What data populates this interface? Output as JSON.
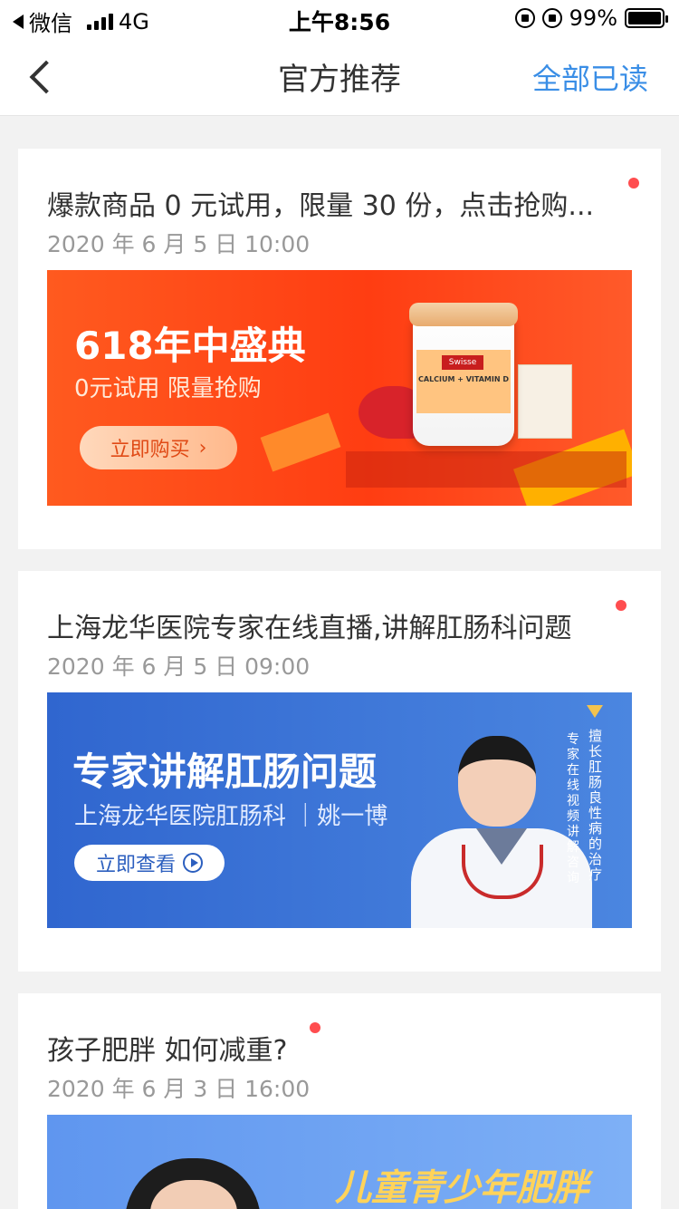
{
  "status_bar": {
    "carrier": "微信",
    "network": "4G",
    "time": "上午8:56",
    "battery": "99%"
  },
  "nav": {
    "title": "官方推荐",
    "right_action": "全部已读"
  },
  "cards": [
    {
      "title": "爆款商品 0 元试用，限量 30 份，点击抢购...",
      "date": "2020 年 6 月 5 日 10:00",
      "banner": {
        "headline": "618年中盛典",
        "subline": "0元试用 限量抢购",
        "button": "立即购买",
        "product_brand": "Swisse",
        "product_name": "CALCIUM + VITAMIN D"
      }
    },
    {
      "title": "上海龙华医院专家在线直播,讲解肛肠科问题",
      "date": "2020 年 6 月 5 日 09:00",
      "banner": {
        "headline": "专家讲解肛肠问题",
        "subline": "上海龙华医院肛肠科 ｜姚一博",
        "button": "立即查看",
        "vertical_right": "擅长肛肠良性病的治疗",
        "vertical_left": "专家在线视频讲解咨询"
      }
    },
    {
      "title": "孩子肥胖 如何减重?",
      "date": "2020 年 6 月 3 日 16:00",
      "banner": {
        "headline": "儿童青少年肥胖"
      }
    }
  ],
  "colors": {
    "accent": "#3a8ee6",
    "unread_dot": "#ff4d4f",
    "banner1_bg": "#ff3d12",
    "banner2_bg": "#3066cf",
    "banner3_bg": "#6ea3f2"
  }
}
